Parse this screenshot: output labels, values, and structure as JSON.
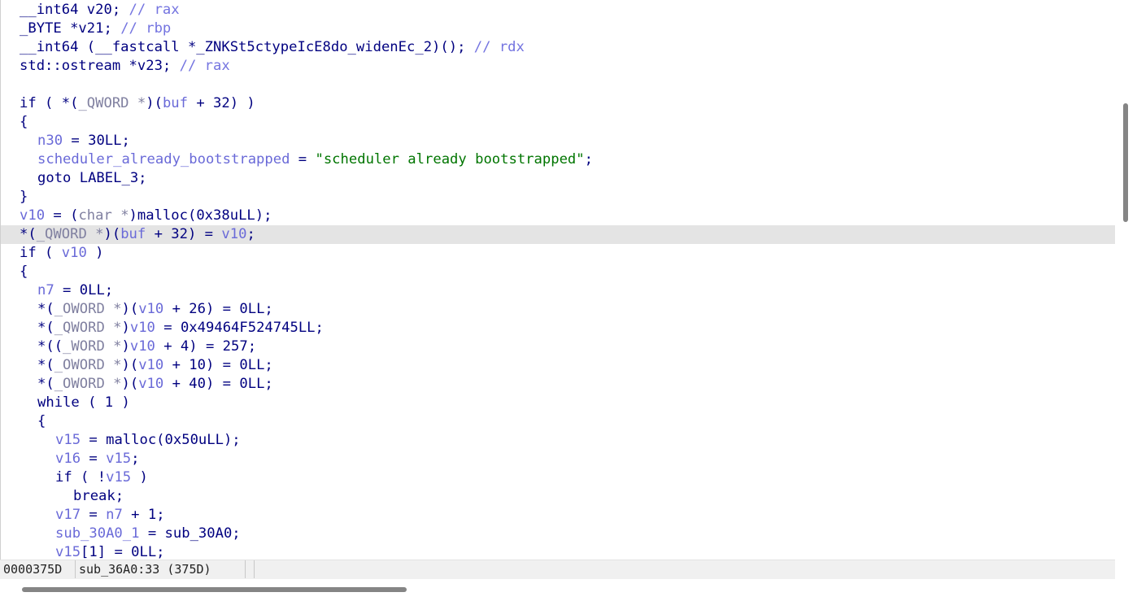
{
  "code": {
    "line_01": {
      "t1": "__int64 v20; ",
      "c1": "// rax"
    },
    "line_02": {
      "t1": "_BYTE *v21; ",
      "c1": "// rbp"
    },
    "line_03": {
      "t1": "__int64 (__fastcall *_ZNKSt5ctypeIcE8do_widenEc_2)(); ",
      "c1": "// rdx"
    },
    "line_04": {
      "t1": "std::ostream *v23; ",
      "c1": "// rax"
    },
    "line_06": {
      "t1": "if ( *(",
      "ty1": "_QWORD *",
      "t2": ")(",
      "v1": "buf",
      "t3": " + 32) )"
    },
    "line_07": {
      "t1": "{"
    },
    "line_08": {
      "v1": "n30",
      "t1": " = 30LL;"
    },
    "line_09": {
      "v1": "scheduler_already_bootstrapped",
      "t1": " = ",
      "s1": "\"scheduler already bootstrapped\"",
      "t2": ";"
    },
    "line_10": {
      "t1": "goto LABEL_3;"
    },
    "line_11": {
      "t1": "}"
    },
    "line_12": {
      "v1": "v10",
      "t1": " = (",
      "ty1": "char *",
      "t2": ")malloc(0x38uLL);"
    },
    "line_13": {
      "t1": "*(",
      "ty1": "_QWORD *",
      "t2": ")(",
      "v1": "buf",
      "t3": " + 32) = ",
      "v2": "v10",
      "t4": ";"
    },
    "line_14": {
      "t1": "if ( ",
      "v1": "v10",
      "t2": " )"
    },
    "line_15": {
      "t1": "{"
    },
    "line_16": {
      "v1": "n7",
      "t1": " = 0LL;"
    },
    "line_17": {
      "t1": "*(",
      "ty1": "_OWORD *",
      "t2": ")(",
      "v1": "v10",
      "t3": " + 26) = 0LL;"
    },
    "line_18": {
      "t1": "*(",
      "ty1": "_QWORD *",
      "t2": ")",
      "v1": "v10",
      "t3": " = 0x49464F524745LL;"
    },
    "line_19": {
      "t1": "*((",
      "ty1": "_WORD *",
      "t2": ")",
      "v1": "v10",
      "t3": " + 4) = 257;"
    },
    "line_20": {
      "t1": "*(",
      "ty1": "_OWORD *",
      "t2": ")(",
      "v1": "v10",
      "t3": " + 10) = 0LL;"
    },
    "line_21": {
      "t1": "*(",
      "ty1": "_OWORD *",
      "t2": ")(",
      "v1": "v10",
      "t3": " + 40) = 0LL;"
    },
    "line_22": {
      "t1": "while ( 1 )"
    },
    "line_23": {
      "t1": "{"
    },
    "line_24": {
      "v1": "v15",
      "t1": " = malloc(0x50uLL);"
    },
    "line_25": {
      "v1": "v16",
      "t1": " = ",
      "v2": "v15",
      "t2": ";"
    },
    "line_26": {
      "t1": "if ( !",
      "v1": "v15",
      "t2": " )"
    },
    "line_27": {
      "t1": "break;"
    },
    "line_28": {
      "v1": "v17",
      "t1": " = ",
      "v2": "n7",
      "t2": " + 1;"
    },
    "line_29": {
      "v1": "sub_30A0_1",
      "t1": " = sub_30A0;"
    },
    "line_30": {
      "v1": "v15",
      "t1": "[1] = 0LL;"
    }
  },
  "statusbar": {
    "address": "0000375D",
    "location": "sub_36A0:33 (375D)"
  },
  "colors": {
    "keyword": "#000080",
    "variable": "#6a6ad8",
    "comment": "#7474e0",
    "string": "#007500",
    "highlight": "#e4e4e4"
  }
}
